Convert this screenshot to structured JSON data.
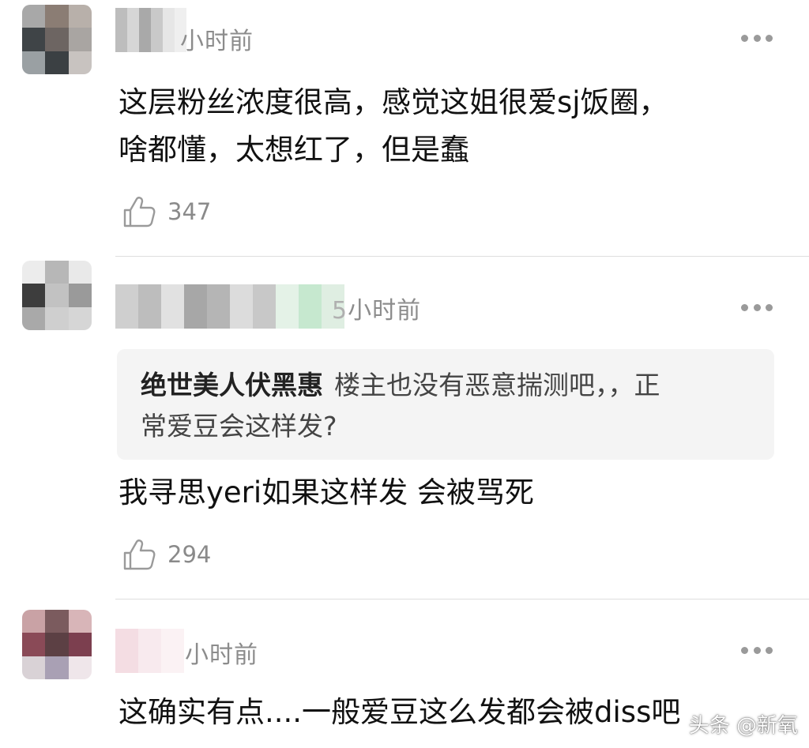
{
  "comments": [
    {
      "time": "小时前",
      "text_line1": "这层粉丝浓度很高，感觉这姐很爱sj饭圈，",
      "text_line2": "啥都懂，太想红了，但是蠢",
      "likes": "347",
      "avatar_colors": [
        "#a8a8a8",
        "#8b7d74",
        "#b8b0aa",
        "#3f4447",
        "#6d6562",
        "#a9a5a2",
        "#9aa0a3",
        "#3b4043",
        "#c8c3c0"
      ],
      "name_colors": [
        "#bdbdbd",
        "#d6d6d6",
        "#a9a9a9",
        "#c9c9c9",
        "#e6e6e6",
        "#efefef"
      ]
    },
    {
      "time": "小时前",
      "time_prefix": "5",
      "quote_author": "绝世美人伏黑惠",
      "quote_text_line1": "楼主也没有恶意揣测吧，，正",
      "quote_text_line2": "常爱豆会这样发?",
      "text": "我寻思yeri如果这样发 会被骂死",
      "likes": "294",
      "avatar_colors": [
        "#ececec",
        "#b7b7b7",
        "#e9e9e9",
        "#3d3d3d",
        "#c2c2c2",
        "#9a9a9a",
        "#a9a9a9",
        "#cfcfcf",
        "#d6d6d6"
      ],
      "name_colors": [
        "#cfcfcf",
        "#bdbdbd",
        "#e1e1e1",
        "#a7a7a7",
        "#b5b5b5",
        "#dcdcdc",
        "#c8c8c8",
        "#e4f2e7",
        "#c6e8cf",
        "#dfeee2"
      ]
    },
    {
      "time": "小时前",
      "text": "这确实有点....一般爱豆这么发都会被diss吧",
      "avatar_colors": [
        "#c9a2a5",
        "#7b5b5e",
        "#d8b5b8",
        "#8a4a57",
        "#5c4044",
        "#7c3f4f",
        "#d9d2d6",
        "#a9a0b4",
        "#efe6ea"
      ],
      "name_colors": [
        "#f4dde3",
        "#f8eaee",
        "#fbf2f4"
      ]
    }
  ],
  "watermark": "头条 @新氧",
  "icons": {
    "like": "thumbs-up-icon",
    "more": "more-dots-icon"
  }
}
